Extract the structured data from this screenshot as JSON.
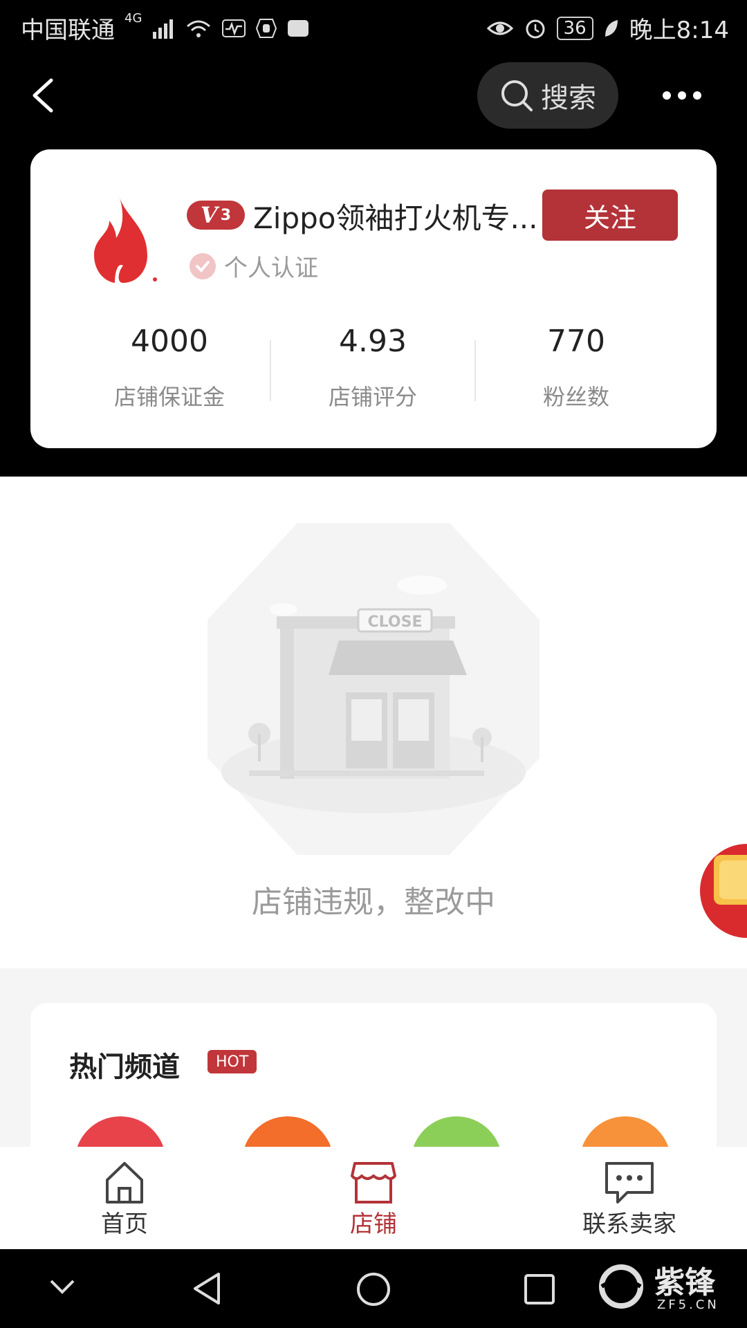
{
  "status_bar": {
    "carrier": "中国联通",
    "network": "4G",
    "battery": "36",
    "time": "晚上8:14"
  },
  "nav": {
    "search_label": "搜索"
  },
  "shop": {
    "level_badge_letter": "V",
    "level_badge_number": "3",
    "name": "Zippo领袖打火机专...",
    "follow_label": "关注",
    "verification": "个人认证",
    "stats": [
      {
        "value": "4000",
        "label": "店铺保证金"
      },
      {
        "value": "4.93",
        "label": "店铺评分"
      },
      {
        "value": "770",
        "label": "粉丝数"
      }
    ]
  },
  "status_message": "店铺违规，整改中",
  "illustration": {
    "sign_text": "CLOSE"
  },
  "hot_section": {
    "title": "热门频道",
    "tag": "HOT",
    "channel_colors": [
      "#e8434b",
      "#f36d2b",
      "#8ccf58",
      "#f7913a"
    ]
  },
  "tabs": [
    {
      "label": "首页",
      "icon": "home-icon",
      "active": false
    },
    {
      "label": "店铺",
      "icon": "store-icon",
      "active": true
    },
    {
      "label": "联系卖家",
      "icon": "chat-icon",
      "active": false
    }
  ],
  "watermark": {
    "brand": "紫锋",
    "domain": "ZF5.CN"
  },
  "colors": {
    "accent": "#b33338",
    "text_primary": "#222222",
    "text_secondary": "#8a8a8a"
  }
}
